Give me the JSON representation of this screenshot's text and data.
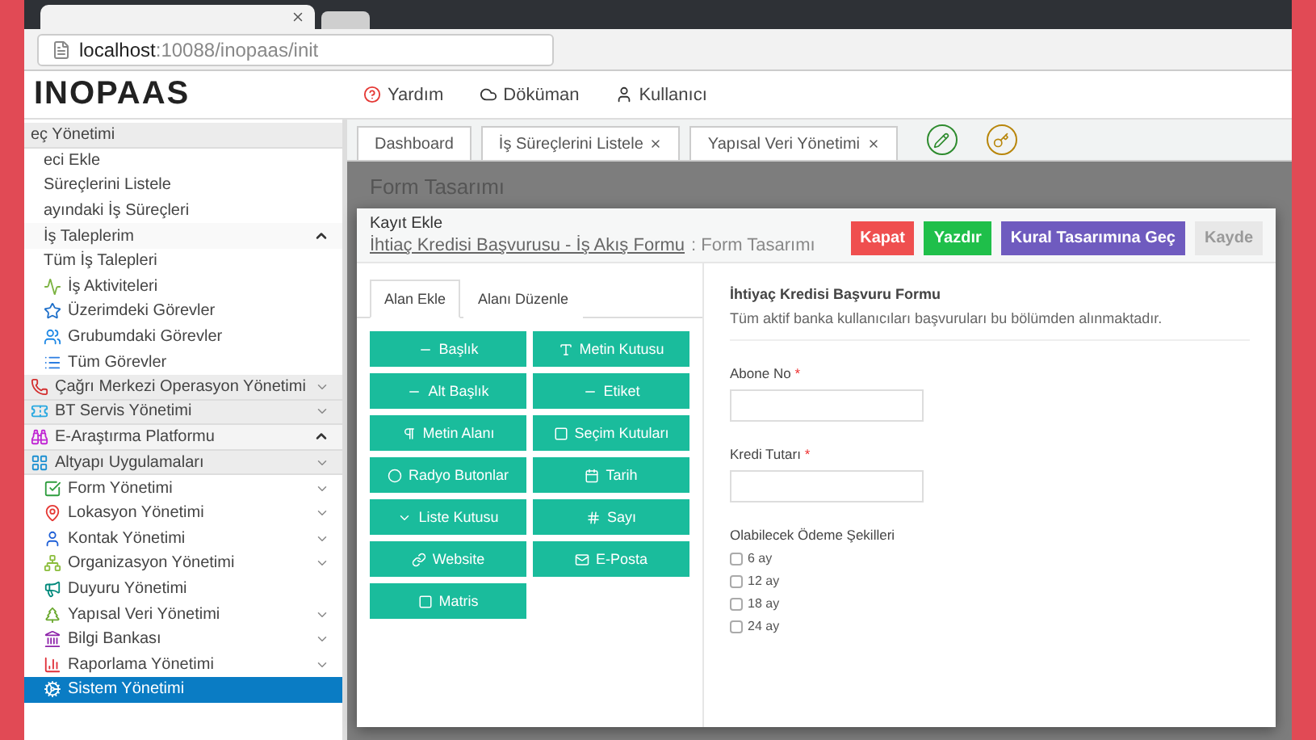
{
  "browser": {
    "address_host": "localhost",
    "address_path": ":10088/inopaas/init"
  },
  "header": {
    "logo": "INOPAAS",
    "links": [
      {
        "label": "Yardım"
      },
      {
        "label": "Döküman"
      },
      {
        "label": "Kullanıcı"
      }
    ]
  },
  "sidebar": {
    "items": [
      {
        "label": "eç Yönetimi",
        "kind": "section",
        "expandable": false,
        "selected": false
      },
      {
        "label": "eci Ekle",
        "kind": "item",
        "expandable": false,
        "selected": false
      },
      {
        "label": "Süreçlerini Listele",
        "kind": "item",
        "expandable": false,
        "selected": false
      },
      {
        "label": "ayındaki İş Süreçleri",
        "kind": "item",
        "expandable": false,
        "selected": false
      },
      {
        "label": "İş Taleplerim",
        "kind": "item",
        "expandable": true,
        "expanded": true,
        "selected": false
      },
      {
        "label": "Tüm İş Talepleri",
        "kind": "item",
        "expandable": false,
        "selected": false
      },
      {
        "label": "İş Aktiviteleri",
        "kind": "item",
        "expandable": false,
        "selected": false,
        "color": "#7cb342"
      },
      {
        "label": "Üzerimdeki Görevler",
        "kind": "item",
        "expandable": false,
        "selected": false,
        "color": "#1e6fc9"
      },
      {
        "label": "Grubumdaki Görevler",
        "kind": "item",
        "expandable": false,
        "selected": false,
        "color": "#1e88e5"
      },
      {
        "label": "Tüm Görevler",
        "kind": "item",
        "expandable": false,
        "selected": false,
        "color": "#2a7de1"
      },
      {
        "label": "Çağrı Merkezi Operasyon Yönetimi",
        "kind": "section",
        "expandable": true,
        "expanded": false,
        "selected": false,
        "color": "#d32f2f"
      },
      {
        "label": "BT Servis Yönetimi",
        "kind": "section",
        "expandable": true,
        "expanded": false,
        "selected": false,
        "color": "#29a8e0"
      },
      {
        "label": "E-Araştırma Platformu",
        "kind": "section",
        "expandable": true,
        "expanded": true,
        "selected": false,
        "color": "#c026d3"
      },
      {
        "label": "Altyapı Uygulamaları",
        "kind": "section",
        "expandable": true,
        "expanded": false,
        "selected": false,
        "color": "#1b8fd1"
      },
      {
        "label": "Form Yönetimi",
        "kind": "item",
        "expandable": true,
        "expanded": false,
        "selected": false,
        "color": "#2e9d3e"
      },
      {
        "label": "Lokasyon Yönetimi",
        "kind": "item",
        "expandable": true,
        "expanded": false,
        "selected": false,
        "color": "#e53935"
      },
      {
        "label": "Kontak Yönetimi",
        "kind": "item",
        "expandable": true,
        "expanded": false,
        "selected": false,
        "color": "#1e5fd6"
      },
      {
        "label": "Organizasyon Yönetimi",
        "kind": "item",
        "expandable": true,
        "expanded": false,
        "selected": false,
        "color": "#8bbd3c"
      },
      {
        "label": "Duyuru Yönetimi",
        "kind": "item",
        "expandable": false,
        "selected": false,
        "color": "#00897b"
      },
      {
        "label": "Yapısal Veri Yönetimi",
        "kind": "item",
        "expandable": true,
        "expanded": false,
        "selected": false,
        "color": "#6aa82f"
      },
      {
        "label": "Bilgi Bankası",
        "kind": "item",
        "expandable": true,
        "expanded": false,
        "selected": false,
        "color": "#8e24aa"
      },
      {
        "label": "Raporlama Yönetimi",
        "kind": "item",
        "expandable": true,
        "expanded": false,
        "selected": false,
        "color": "#e0303a"
      },
      {
        "label": "Sistem Yönetimi",
        "kind": "item",
        "expandable": false,
        "selected": true,
        "color": "#ffffff"
      }
    ]
  },
  "tabs": [
    {
      "label": "Dashboard",
      "closable": false
    },
    {
      "label": "İş Süreçlerini Listele",
      "closable": true
    },
    {
      "label": "Yapısal Veri Yönetimi",
      "closable": true
    }
  ],
  "page_title": "Form Tasarımı",
  "modal": {
    "title": "Kayıt Ekle",
    "breadcrumb_link": "İhtiaç Kredisi Başvurusu - İş Akış Formu",
    "breadcrumb_rest": ": Form Tasarımı",
    "buttons": [
      {
        "label": "Kapat",
        "color": "#ef4f4f"
      },
      {
        "label": "Yazdır",
        "color": "#1fbf4a"
      },
      {
        "label": "Kural Tasarımına Geç",
        "color": "#6f5bbf"
      },
      {
        "label": "Kayde",
        "color": "#e8e8e8"
      }
    ],
    "panel_tabs": [
      {
        "label": "Alan Ekle",
        "selected": true
      },
      {
        "label": "Alanı Düzenle",
        "selected": false
      }
    ],
    "field_buttons": [
      {
        "label": "Başlık"
      },
      {
        "label": "Metin Kutusu"
      },
      {
        "label": "Alt Başlık"
      },
      {
        "label": "Etiket"
      },
      {
        "label": "Metin Alanı"
      },
      {
        "label": "Seçim Kutuları"
      },
      {
        "label": "Radyo Butonlar"
      },
      {
        "label": "Tarih"
      },
      {
        "label": "Liste Kutusu"
      },
      {
        "label": "Sayı"
      },
      {
        "label": "Website"
      },
      {
        "label": "E-Posta"
      },
      {
        "label": "Matris"
      }
    ],
    "preview": {
      "title": "İhtiyaç Kredisi Başvuru Formu",
      "description": "Tüm aktif banka kullanıcıları başvuruları bu bölümden alınmaktadır.",
      "fields": [
        {
          "label": "Abone No",
          "required_mark": "*"
        },
        {
          "label": "Kredi Tutarı",
          "required_mark": "*"
        }
      ],
      "options_label": "Olabilecek Ödeme Şekilleri",
      "options": [
        {
          "label": "6 ay",
          "checked": false
        },
        {
          "label": "12 ay",
          "checked": false
        },
        {
          "label": "18 ay",
          "checked": false
        },
        {
          "label": "24 ay",
          "checked": false
        }
      ]
    }
  }
}
